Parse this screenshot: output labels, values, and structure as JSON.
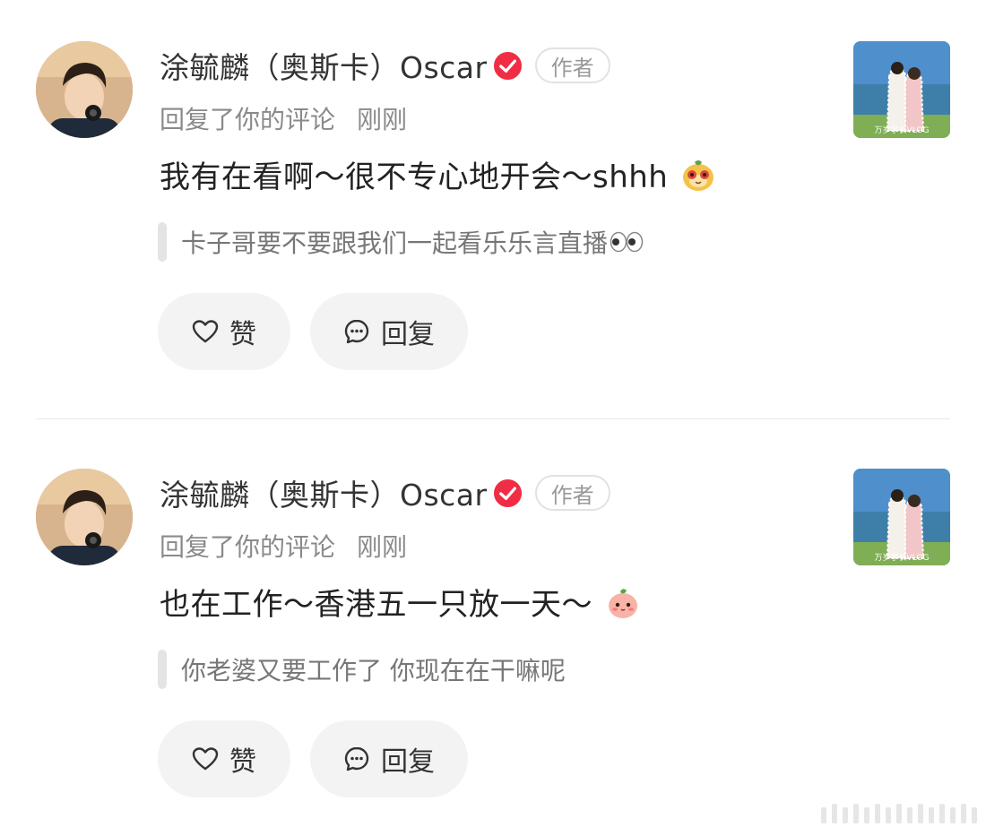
{
  "comments": [
    {
      "username": "涂毓麟（奥斯卡）Oscar",
      "author_badge": "作者",
      "action": "回复了你的评论",
      "time": "刚刚",
      "reply_text": "我有在看啊～很不专心地开会～shhh",
      "reply_emoji": "yellow-mascot-emoji",
      "quoted_text": "卡子哥要不要跟我们一起看乐乐言直播",
      "quoted_emoji": "eyes-emoji",
      "thumbnail_caption": "万岁学长VLOG",
      "like_label": "赞",
      "reply_label": "回复"
    },
    {
      "username": "涂毓麟（奥斯卡）Oscar",
      "author_badge": "作者",
      "action": "回复了你的评论",
      "time": "刚刚",
      "reply_text": "也在工作～香港五一只放一天～",
      "reply_emoji": "pink-peach-emoji",
      "quoted_text": "你老婆又要工作了 你现在在干嘛呢",
      "thumbnail_caption": "万岁学长VLOG",
      "like_label": "赞",
      "reply_label": "回复"
    }
  ],
  "colors": {
    "verified_badge": "#f02d45",
    "button_bg": "#f3f3f3",
    "meta_text": "#8a8a8a",
    "quote_text": "#777777"
  }
}
